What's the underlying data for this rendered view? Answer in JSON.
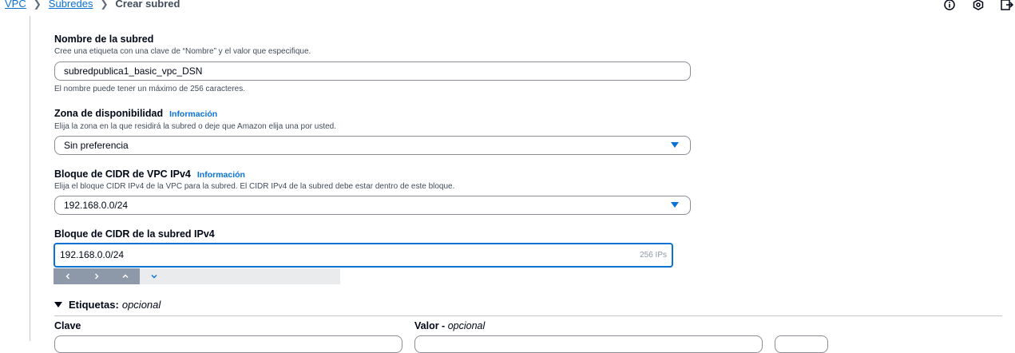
{
  "breadcrumb": {
    "vpc": "VPC",
    "subnets": "Subredes",
    "current": "Crear subred"
  },
  "subnet_name": {
    "label": "Nombre de la subred",
    "description": "Cree una etiqueta con una clave de “Nombre” y el valor que especifique.",
    "value": "subredpublica1_basic_vpc_DSN",
    "hint": "El nombre puede tener un máximo de 256 caracteres."
  },
  "availability_zone": {
    "label": "Zona de disponibilidad",
    "info": "Información",
    "description": "Elija la zona en la que residirá la subred o deje que Amazon elija una por usted.",
    "value": "Sin preferencia"
  },
  "vpc_cidr": {
    "label": "Bloque de CIDR de VPC IPv4",
    "info": "Información",
    "description": "Elija el bloque CIDR IPv4 de la VPC para la subred. El CIDR IPv4 de la subred debe estar dentro de este bloque.",
    "value": "192.168.0.0/24"
  },
  "subnet_cidr": {
    "label": "Bloque de CIDR de la subred IPv4",
    "value": "192.168.0.0/24",
    "count": "256 IPs"
  },
  "tags": {
    "title": "Etiquetas:",
    "title_optional": "opcional",
    "key_label": "Clave",
    "value_label": "Valor - ",
    "value_optional": "opcional"
  },
  "icons": [
    "info-circle-icon",
    "settings-gear-icon",
    "split-panel-icon",
    "chevron-left-icon",
    "chevron-right-icon",
    "chevron-up-icon",
    "chevron-down-icon",
    "caret-down-icon"
  ],
  "colors": {
    "accent": "#0972d3",
    "text": "#000716",
    "muted": "#414d5c",
    "border": "#8c8c94"
  }
}
